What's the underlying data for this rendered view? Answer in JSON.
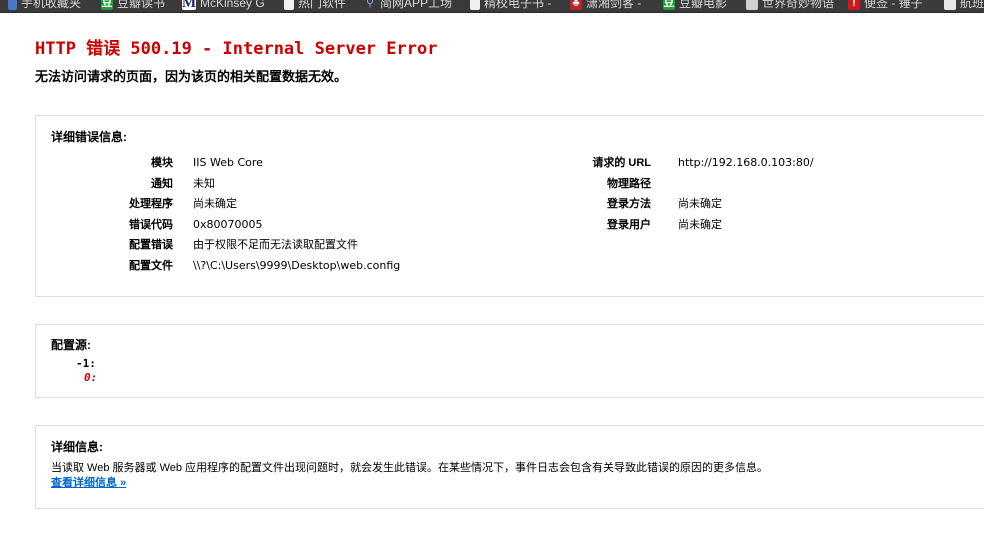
{
  "bookmarks": [
    {
      "label": "手机收藏夹",
      "icon": "phone-icon"
    },
    {
      "label": "豆瓣读书",
      "icon": "douban-icon"
    },
    {
      "label": "McKinsey G",
      "icon": "mckinsey-icon"
    },
    {
      "label": "热门软件",
      "icon": "document-icon"
    },
    {
      "label": "简网APP工场",
      "icon": "link-icon"
    },
    {
      "label": "精校电子书 -",
      "icon": "document-icon"
    },
    {
      "label": "潇湘剑客 -",
      "icon": "red-icon"
    },
    {
      "label": "豆瓣电影",
      "icon": "douban-icon"
    },
    {
      "label": "世界奇妙物语",
      "icon": "mail-icon"
    },
    {
      "label": "便签 - 锤子",
      "icon": "pin-icon"
    },
    {
      "label": "航班",
      "icon": "github-icon"
    }
  ],
  "error": {
    "title": "HTTP 错误 500.19 - Internal Server Error",
    "subtitle": "无法访问请求的页面，因为该页的相关配置数据无效。"
  },
  "details": {
    "heading": "详细错误信息:",
    "left": [
      {
        "key": "模块",
        "value": "IIS Web Core"
      },
      {
        "key": "通知",
        "value": "未知"
      },
      {
        "key": "处理程序",
        "value": "尚未确定"
      },
      {
        "key": "错误代码",
        "value": "0x80070005"
      },
      {
        "key": "配置错误",
        "value": "由于权限不足而无法读取配置文件"
      },
      {
        "key": "配置文件",
        "value": "\\\\?\\C:\\Users\\9999\\Desktop\\web.config"
      }
    ],
    "right": [
      {
        "key": "请求的 URL",
        "value": "http://192.168.0.103:80/"
      },
      {
        "key": "物理路径",
        "value": ""
      },
      {
        "key": "登录方法",
        "value": "尚未确定"
      },
      {
        "key": "登录用户",
        "value": "尚未确定"
      }
    ]
  },
  "config_source": {
    "heading": "配置源:",
    "line1": "-1:",
    "line2": "0:"
  },
  "more_info": {
    "heading": "详细信息:",
    "description": "当读取 Web 服务器或 Web 应用程序的配置文件出现问题时，就会发生此错误。在某些情况下，事件日志会包含有关导致此错误的原因的更多信息。",
    "link": "查看详细信息 »"
  },
  "colors": {
    "title": "#cc0000",
    "link": "#0066cc",
    "box_border": "#dddddd",
    "bookmark_bar": "#3a3a3a"
  }
}
